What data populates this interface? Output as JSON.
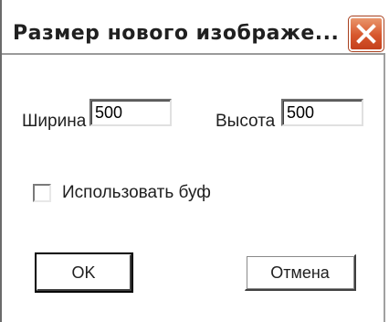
{
  "dialog": {
    "title": "Размер нового изображе...",
    "close_icon": "close-icon",
    "accent_close_color": "#d7572d"
  },
  "fields": {
    "width_label": "Ширина",
    "width_value": "500",
    "height_label": "Высота",
    "height_value": "500"
  },
  "options": {
    "use_buffer_label": "Использовать буф",
    "use_buffer_checked": false
  },
  "buttons": {
    "ok_label": "OK",
    "cancel_label": "Отмена"
  }
}
